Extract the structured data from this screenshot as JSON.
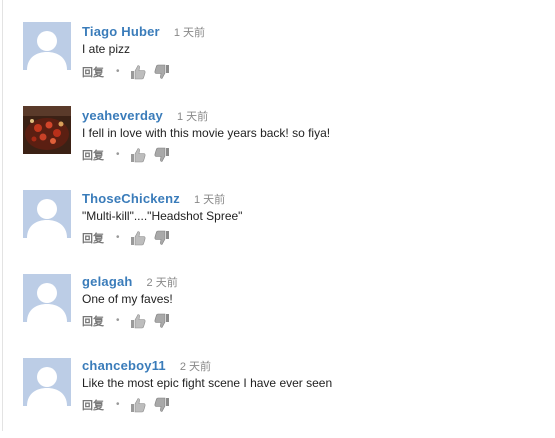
{
  "comments": [
    {
      "author": "Tiago Huber",
      "time": "1 天前",
      "text": "I ate pizz",
      "reply_label": "回复",
      "avatar": "default-avatar"
    },
    {
      "author": "yeaheverday",
      "time": "1 天前",
      "text": "I fell in love with this movie years back! so fiya!",
      "reply_label": "回复",
      "avatar": "photo-avatar"
    },
    {
      "author": "ThoseChickenz",
      "time": "1 天前",
      "text": "\"Multi-kill\"....\"Headshot Spree\"",
      "reply_label": "回复",
      "avatar": "default-avatar"
    },
    {
      "author": "gelagah",
      "time": "2 天前",
      "text": "One of my faves!",
      "reply_label": "回复",
      "avatar": "default-avatar"
    },
    {
      "author": "chanceboy11",
      "time": "2 天前",
      "text": "Like the most epic fight scene I have ever seen",
      "reply_label": "回复",
      "avatar": "default-avatar"
    }
  ],
  "icons": {
    "separator": "dot-separator",
    "like": "thumbs-up-icon",
    "dislike": "thumbs-down-icon"
  },
  "colors": {
    "author": "#3a7cba",
    "avatar_bg": "#bccde6",
    "avatar_fg": "#ffffff",
    "text": "#222222",
    "meta": "#888888"
  }
}
